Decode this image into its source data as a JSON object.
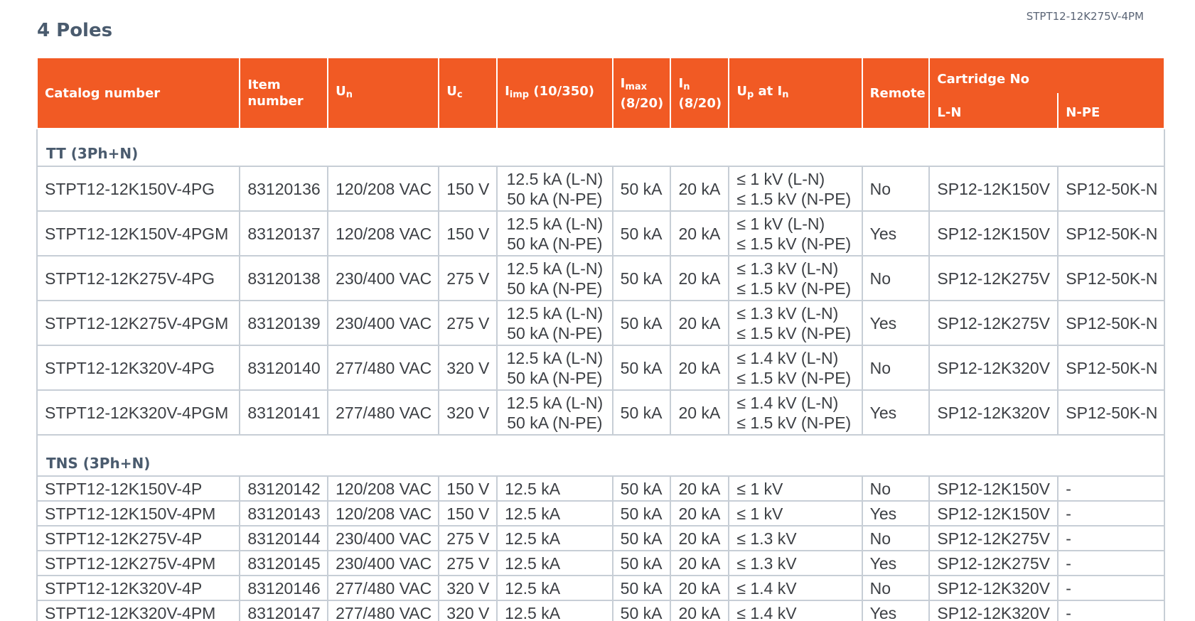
{
  "document": {
    "reference": "STPT12-12K275V-4PM",
    "heading": "4 Poles"
  },
  "table": {
    "headers": {
      "catalog_number": "Catalog number",
      "item_number": "Item number",
      "un": {
        "main": "U",
        "sub": "n"
      },
      "uc": {
        "main": "U",
        "sub": "c"
      },
      "iimp": {
        "main": "I",
        "sub": "imp",
        "suffix": " (10/350)"
      },
      "imax": {
        "main": "I",
        "sub": "max",
        "line2": "(8/20)"
      },
      "in": {
        "main": "I",
        "sub": "n",
        "line2": "(8/20)"
      },
      "up": {
        "main": "U",
        "sub": "p",
        "mid": " at I",
        "sub2": "n"
      },
      "remote": "Remote",
      "cartridge": "Cartridge No",
      "cartridge_ln": "L-N",
      "cartridge_npe": "N-PE"
    },
    "groups": [
      {
        "title": "TT (3Ph+N)",
        "rows": [
          {
            "catalog": "STPT12-12K150V-4PG",
            "item": "83120136",
            "un": "120/208 VAC",
            "uc": "150 V",
            "iimp": [
              "12.5 kA (L-N)",
              "50 kA (N-PE)"
            ],
            "imax": "50 kA",
            "in": "20 kA",
            "up": [
              "≤ 1 kV (L-N)",
              "≤ 1.5 kV (N-PE)"
            ],
            "remote": "No",
            "ln": "SP12-12K150V",
            "npe": "SP12-50K-N"
          },
          {
            "catalog": "STPT12-12K150V-4PGM",
            "item": "83120137",
            "un": "120/208 VAC",
            "uc": "150 V",
            "iimp": [
              "12.5 kA (L-N)",
              "50 kA (N-PE)"
            ],
            "imax": "50 kA",
            "in": "20 kA",
            "up": [
              "≤ 1 kV (L-N)",
              "≤ 1.5 kV (N-PE)"
            ],
            "remote": "Yes",
            "ln": "SP12-12K150V",
            "npe": "SP12-50K-N"
          },
          {
            "catalog": "STPT12-12K275V-4PG",
            "item": "83120138",
            "un": "230/400 VAC",
            "uc": "275 V",
            "iimp": [
              "12.5 kA (L-N)",
              "50 kA (N-PE)"
            ],
            "imax": "50 kA",
            "in": "20 kA",
            "up": [
              "≤ 1.3 kV (L-N)",
              "≤ 1.5 kV (N-PE)"
            ],
            "remote": "No",
            "ln": "SP12-12K275V",
            "npe": "SP12-50K-N"
          },
          {
            "catalog": "STPT12-12K275V-4PGM",
            "item": "83120139",
            "un": "230/400 VAC",
            "uc": "275 V",
            "iimp": [
              "12.5 kA (L-N)",
              "50 kA (N-PE)"
            ],
            "imax": "50 kA",
            "in": "20 kA",
            "up": [
              "≤ 1.3 kV (L-N)",
              "≤ 1.5 kV (N-PE)"
            ],
            "remote": "Yes",
            "ln": "SP12-12K275V",
            "npe": "SP12-50K-N"
          },
          {
            "catalog": "STPT12-12K320V-4PG",
            "item": "83120140",
            "un": "277/480 VAC",
            "uc": "320 V",
            "iimp": [
              "12.5 kA (L-N)",
              "50 kA (N-PE)"
            ],
            "imax": "50 kA",
            "in": "20 kA",
            "up": [
              "≤ 1.4 kV (L-N)",
              "≤ 1.5 kV (N-PE)"
            ],
            "remote": "No",
            "ln": "SP12-12K320V",
            "npe": "SP12-50K-N"
          },
          {
            "catalog": "STPT12-12K320V-4PGM",
            "item": "83120141",
            "un": "277/480 VAC",
            "uc": "320 V",
            "iimp": [
              "12.5 kA (L-N)",
              "50 kA (N-PE)"
            ],
            "imax": "50 kA",
            "in": "20 kA",
            "up": [
              "≤ 1.4 kV (L-N)",
              "≤ 1.5 kV (N-PE)"
            ],
            "remote": "Yes",
            "ln": "SP12-12K320V",
            "npe": "SP12-50K-N"
          }
        ]
      },
      {
        "title": "TNS (3Ph+N)",
        "rows": [
          {
            "catalog": "STPT12-12K150V-4P",
            "item": "83120142",
            "un": "120/208 VAC",
            "uc": "150 V",
            "iimp": [
              "12.5 kA"
            ],
            "imax": "50 kA",
            "in": "20 kA",
            "up": [
              "≤ 1 kV"
            ],
            "remote": "No",
            "ln": "SP12-12K150V",
            "npe": "-"
          },
          {
            "catalog": "STPT12-12K150V-4PM",
            "item": "83120143",
            "un": "120/208 VAC",
            "uc": "150 V",
            "iimp": [
              "12.5 kA"
            ],
            "imax": "50 kA",
            "in": "20 kA",
            "up": [
              "≤ 1 kV"
            ],
            "remote": "Yes",
            "ln": "SP12-12K150V",
            "npe": "-"
          },
          {
            "catalog": "STPT12-12K275V-4P",
            "item": "83120144",
            "un": "230/400 VAC",
            "uc": "275 V",
            "iimp": [
              "12.5 kA"
            ],
            "imax": "50 kA",
            "in": "20 kA",
            "up": [
              "≤ 1.3 kV"
            ],
            "remote": "No",
            "ln": "SP12-12K275V",
            "npe": "-"
          },
          {
            "catalog": "STPT12-12K275V-4PM",
            "item": "83120145",
            "un": "230/400 VAC",
            "uc": "275 V",
            "iimp": [
              "12.5 kA"
            ],
            "imax": "50 kA",
            "in": "20 kA",
            "up": [
              "≤ 1.3 kV"
            ],
            "remote": "Yes",
            "ln": "SP12-12K275V",
            "npe": "-"
          },
          {
            "catalog": "STPT12-12K320V-4P",
            "item": "83120146",
            "un": "277/480 VAC",
            "uc": "320 V",
            "iimp": [
              "12.5 kA"
            ],
            "imax": "50 kA",
            "in": "20 kA",
            "up": [
              "≤ 1.4 kV"
            ],
            "remote": "No",
            "ln": "SP12-12K320V",
            "npe": "-"
          },
          {
            "catalog": "STPT12-12K320V-4PM",
            "item": "83120147",
            "un": "277/480 VAC",
            "uc": "320 V",
            "iimp": [
              "12.5 kA"
            ],
            "imax": "50 kA",
            "in": "20 kA",
            "up": [
              "≤ 1.4 kV"
            ],
            "remote": "Yes",
            "ln": "SP12-12K320V",
            "npe": "-"
          }
        ]
      }
    ]
  },
  "colors": {
    "header_bg": "#f15a24",
    "header_text": "#ffffff",
    "heading_text": "#4a5b6e",
    "grid": "#c7ced6"
  }
}
